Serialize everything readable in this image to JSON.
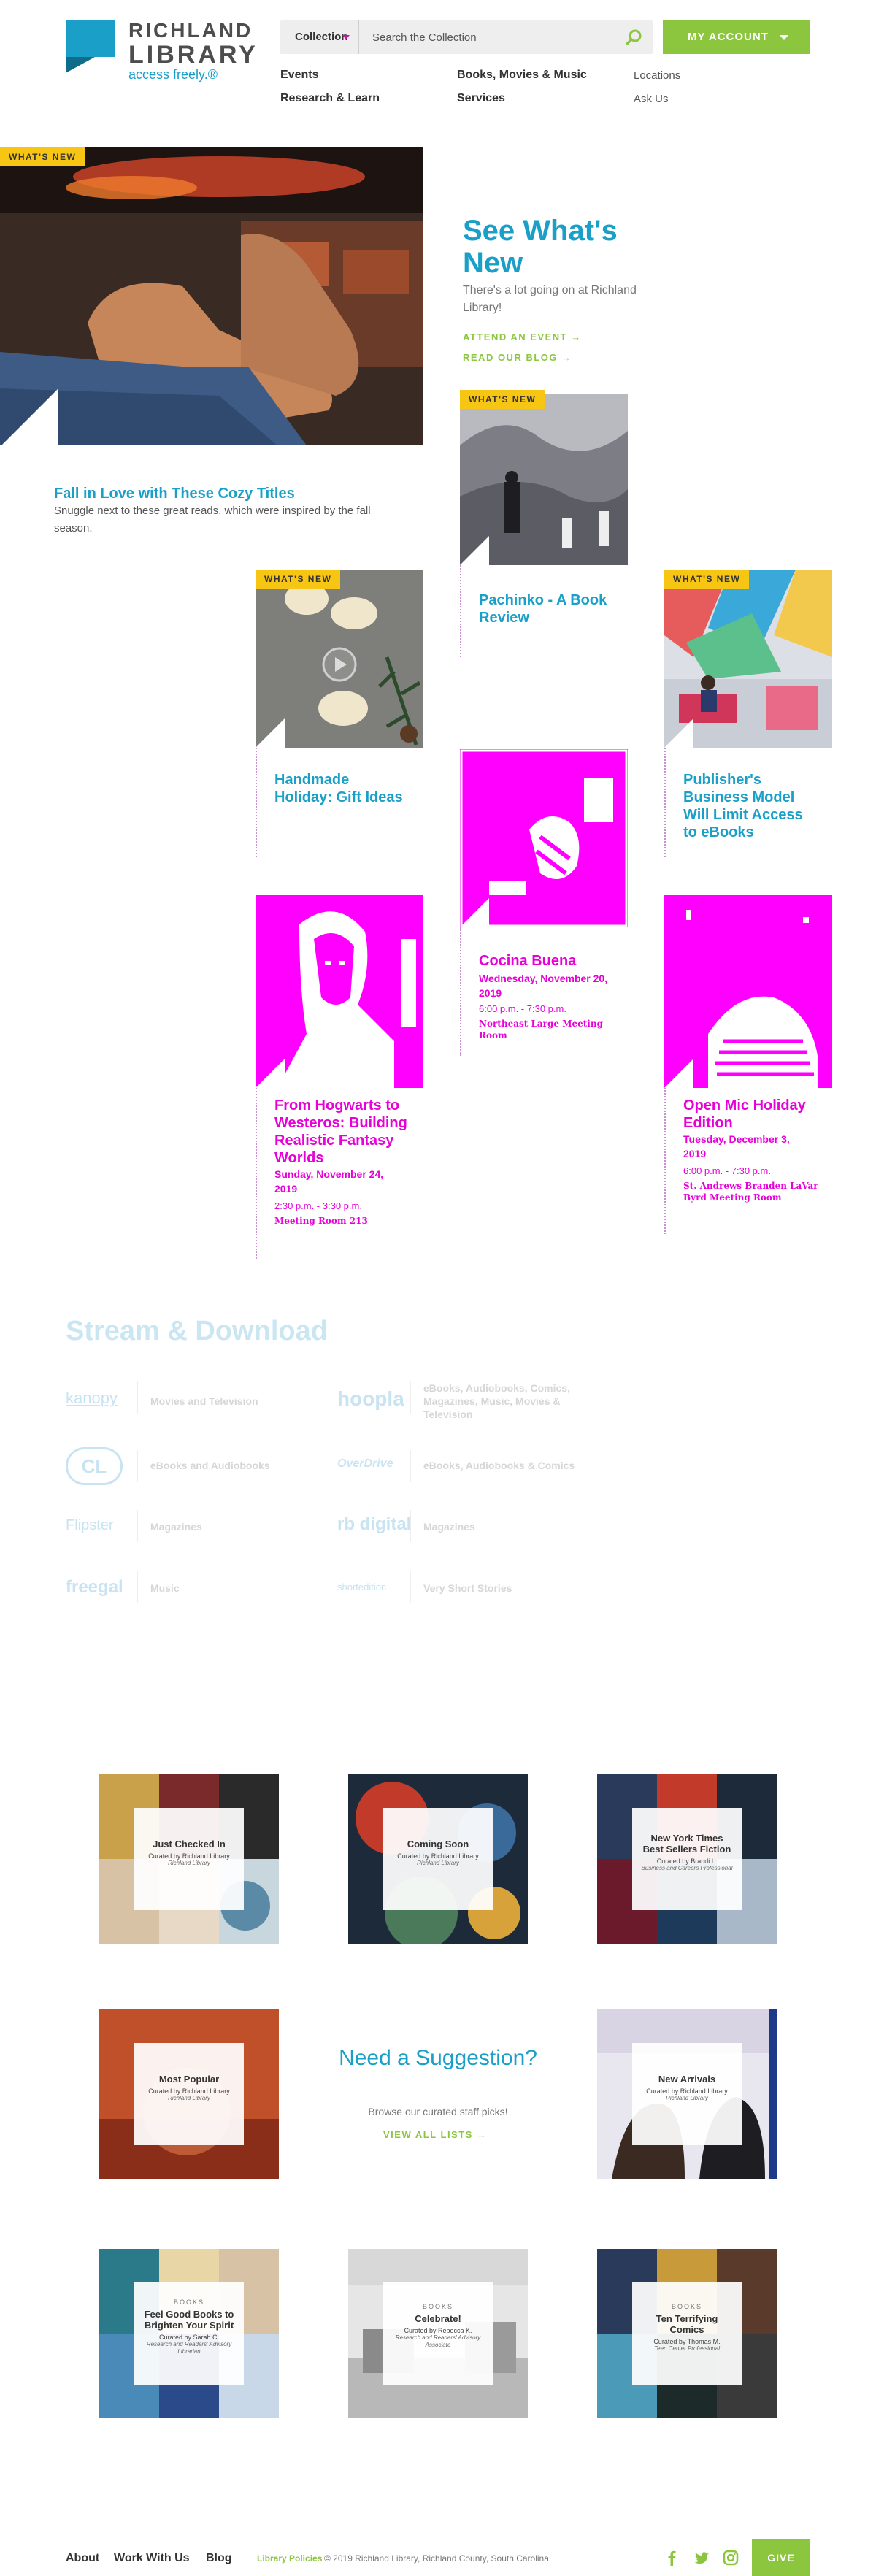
{
  "header": {
    "logo_line1": "RICHLAND",
    "logo_line2": "LIBRARY",
    "logo_tagline": "access freely.®",
    "search_category": "Collection",
    "search_placeholder": "Search the Collection",
    "account_label": "MY ACCOUNT",
    "nav": [
      "Events",
      "Books, Movies & Music",
      "Research & Learn",
      "Services"
    ],
    "nav_secondary": [
      "Locations",
      "Ask Us"
    ]
  },
  "hero": {
    "badge": "WHAT'S NEW",
    "title": "See What's New",
    "subtitle": "There's a lot going on at Richland Library!",
    "link_event": "ATTEND AN EVENT →",
    "link_blog": "READ OUR BLOG →",
    "feature_title": "Fall in Love with These Cozy Titles",
    "feature_desc": "Snuggle next to these great reads, which were inspired by the fall season."
  },
  "cards": {
    "pachinko": {
      "badge": "WHAT'S NEW",
      "title": "Pachinko - A Book Review"
    },
    "handmade": {
      "badge": "WHAT'S NEW",
      "title": "Handmade Holiday: Gift Ideas"
    },
    "publisher": {
      "badge": "WHAT'S NEW",
      "title": "Publisher's Business Model Will Limit Access to eBooks"
    },
    "cocina": {
      "title": "Cocina Buena",
      "date": "Wednesday, November 20, 2019",
      "time": "6:00 p.m. - 7:30 p.m.",
      "room": "Northeast Large Meeting Room"
    },
    "hogwarts": {
      "title": "From Hogwarts to Westeros: Building Realistic Fantasy Worlds",
      "date": "Sunday, November 24, 2019",
      "time": "2:30 p.m. - 3:30 p.m.",
      "room": "Meeting Room 213"
    },
    "openmic": {
      "title": "Open Mic Holiday Edition",
      "date": "Tuesday, December 3, 2019",
      "time": "6:00 p.m. - 7:30 p.m.",
      "room": "St. Andrews Branden LaVar Byrd Meeting Room"
    }
  },
  "stream": {
    "title": "Stream & Download",
    "items": [
      {
        "logo": "kanopy",
        "desc": "Movies and Television"
      },
      {
        "logo": "hoopla",
        "desc": "eBooks, Audiobooks, Comics, Magazines, Music, Movies & Television"
      },
      {
        "logo": "CL",
        "desc": "eBooks and Audiobooks"
      },
      {
        "logo": "OverDrive",
        "desc": "eBooks, Audiobooks & Comics"
      },
      {
        "logo": "Flipster",
        "desc": "Magazines"
      },
      {
        "logo": "rb digital",
        "desc": "Magazines"
      },
      {
        "logo": "freegal",
        "desc": "Music"
      },
      {
        "logo": "shortedition",
        "desc": "Very Short Stories"
      }
    ]
  },
  "lists": {
    "just_checked": {
      "title": "Just Checked In",
      "curator": "Curated by Richland Library",
      "by": "Richland Library"
    },
    "coming_soon": {
      "title": "Coming Soon",
      "curator": "Curated by Richland Library",
      "by": "Richland Library"
    },
    "nyt": {
      "title": "New York Times Best Sellers Fiction",
      "curator": "Curated by Brandi L.",
      "by": "Business and Careers Professional"
    },
    "most_popular": {
      "title": "Most Popular",
      "curator": "Curated by Richland Library",
      "by": "Richland Library"
    },
    "new_arrivals": {
      "title": "New Arrivals",
      "curator": "Curated by Richland Library",
      "by": "Richland Library"
    },
    "feel_good": {
      "kicker": "BOOKS",
      "title": "Feel Good Books to Brighten Your Spirit",
      "curator": "Curated by Sarah C.",
      "by": "Research and Readers' Advisory Librarian"
    },
    "celebrate": {
      "kicker": "BOOKS",
      "title": "Celebrate!",
      "curator": "Curated by Rebecca K.",
      "by": "Research and Readers' Advisory Associate"
    },
    "terrifying": {
      "kicker": "BOOKS",
      "title": "Ten Terrifying Comics",
      "curator": "Curated by Thomas M.",
      "by": "Teen Center Professional"
    }
  },
  "suggestion": {
    "title": "Need a Suggestion?",
    "subtitle": "Browse our curated staff picks!",
    "link": "VIEW ALL LISTS →"
  },
  "footer": {
    "links": [
      "About",
      "Work With Us",
      "Blog"
    ],
    "policies": "Library Policies",
    "copyright": "© 2019 Richland Library, Richland County, South Carolina",
    "give": "GIVE"
  },
  "colors": {
    "brand_blue": "#1aa0c8",
    "accent_green": "#8cc63f",
    "badge_yellow": "#f7c615",
    "event_magenta": "#e800d9"
  }
}
